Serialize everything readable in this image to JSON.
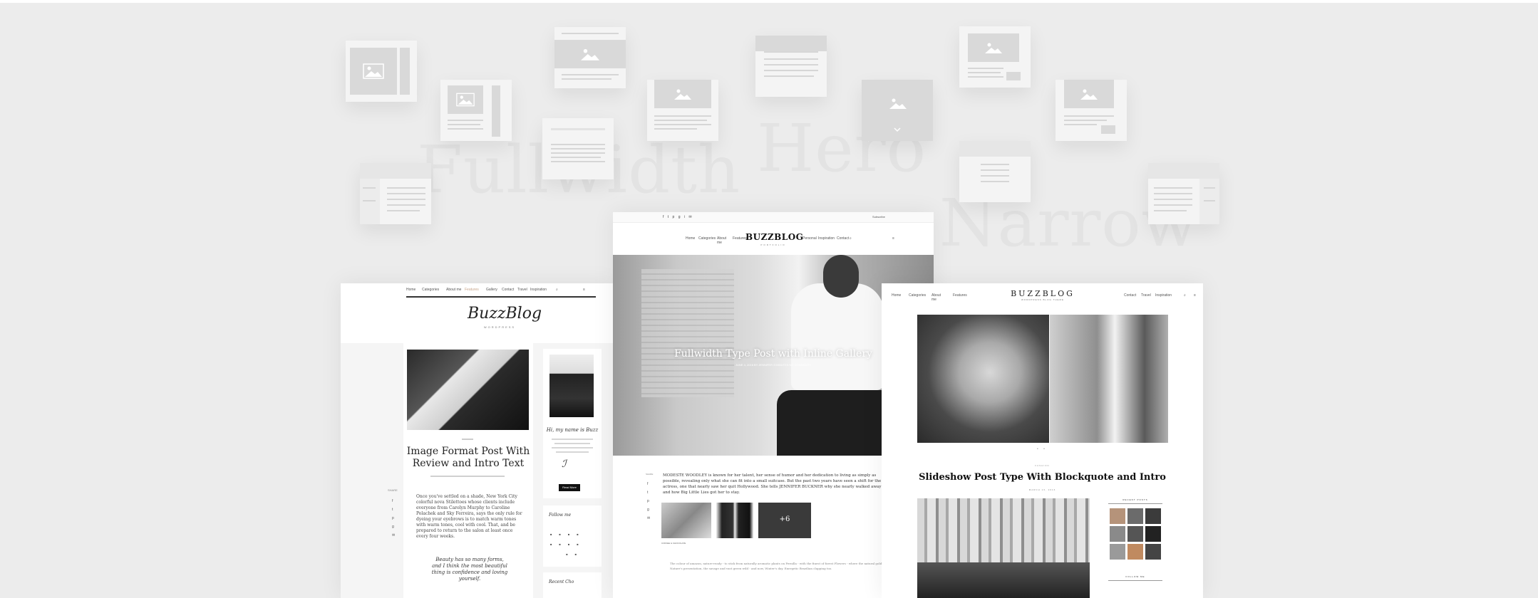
{
  "ghost_labels": {
    "fullwidth": "Fullwidth",
    "hero": "Hero",
    "narrow": "Narrow"
  },
  "left_card": {
    "nav": [
      "Home",
      "Categories",
      "About me",
      "Features",
      "Gallery",
      "Contact",
      "Travel",
      "Inspiration"
    ],
    "logo": "BuzzBlog",
    "logo_tagline": "WORDPRESS",
    "post_title_1": "Image Format Post With",
    "post_title_2": "Review and Intro Text",
    "sidebar_heading": "Hi, my name is Buzz",
    "sidebar_button": "Read More",
    "follow_heading": "Follow me",
    "recent_heading": "Recent Cho",
    "share_label": "SHARE",
    "body_text": "Once you've settled on a shade, New York City colorful nova Stilettoes whose clients include everyone from Carolyn Murphy to Caroline Polachek and Sky Ferreira, says the only rule for dyeing your eyebrows is to match warm tones with warm tones, cool with cool. That, and be prepared to return to the salon at least once every four weeks.",
    "quote_text": "Beauty has so many forms, and I think the most beautiful thing is confidence and loving yourself."
  },
  "center_card": {
    "top_right": "Subscribe",
    "logo": "BUZZBLOG",
    "logo_tagline": "PORTFOLIO",
    "nav_left": [
      "Home",
      "Categories",
      "About me",
      "Features"
    ],
    "nav_right": [
      "Personal",
      "Inspiration",
      "Contact"
    ],
    "hero_title": "Fullwidth Type Post with Inline Gallery",
    "hero_meta": "JUNE 4, 2016   BY JENNIFER   3 MINUTES   NO COMMENTS",
    "share_label": "SHARE",
    "body_text": "MODESTE WOODLEY is known for her talent, her sense of humor and her dedication to living as simply as possible, revealing only what she can fit into a small suitcase. But the past two years have seen a shift for the actress, one that nearly saw her quit Hollywood. She tells JENNIFER BUCKNER why she nearly walked away and how Big Little Lies got her to stay.",
    "caption": "COFFEE & CHOCOLATE",
    "gallery_count": "+6",
    "footer_text": "The colour of amazon, nature-ready - to stick from naturally aromatic plants on Pernilla - with the finest of forest Flowers - where the natural gold of Nature's presentation, the savage and vast green wild - and now, Winter's day. Energetic Brazilian clapping too."
  },
  "right_card": {
    "nav_left": [
      "Home",
      "Categories",
      "About me",
      "Features"
    ],
    "nav_right": [
      "Contact",
      "Travel",
      "Inspiration"
    ],
    "logo": "BUZZBLOG",
    "logo_tagline": "WORDPRESS BLOG THEME",
    "category": "FASHION",
    "post_title": "Slideshow Post Type With Blockquote and Intro",
    "date": "MARCH 13, 2016",
    "widget_1": "RECENT POSTS",
    "widget_2": "FOLLOW ME"
  }
}
